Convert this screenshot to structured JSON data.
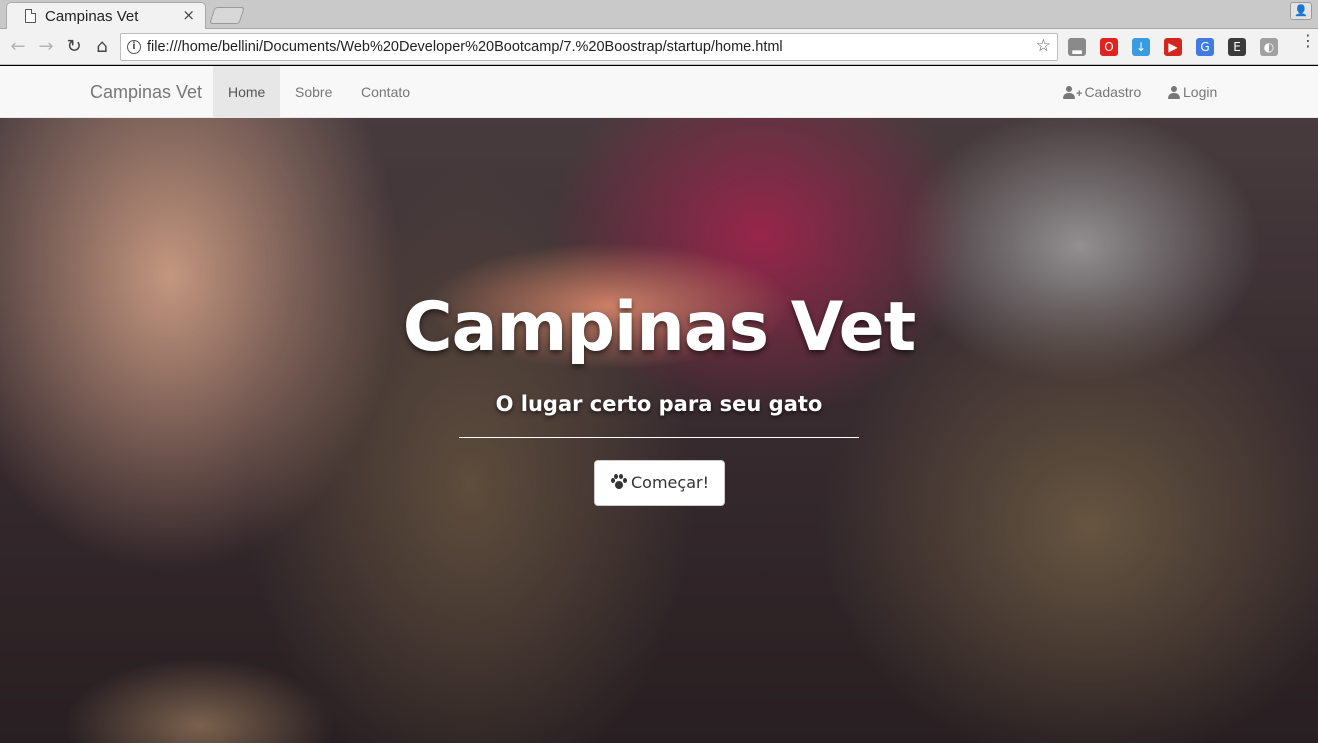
{
  "browser": {
    "tab_title": "Campinas Vet",
    "tab_close": "×",
    "url": "file:///home/bellini/Documents/Web%20Developer%20Bootcamp/7.%20Boostrap/startup/home.html",
    "info_icon": "i",
    "star_icon": "☆",
    "back_icon": "←",
    "forward_icon": "→",
    "reload_icon": "↻",
    "home_icon": "⌂",
    "menu_icon": "⋮",
    "profile_icon": "👤",
    "extensions": [
      {
        "name": "signal-extension-icon",
        "color": "#8a8a8a",
        "glyph": "▂"
      },
      {
        "name": "opera-extension-icon",
        "color": "#e0231f",
        "glyph": "O"
      },
      {
        "name": "download-extension-icon",
        "color": "#3a9ce0",
        "glyph": "↓"
      },
      {
        "name": "red-extension-icon",
        "color": "#d4261f",
        "glyph": "▶"
      },
      {
        "name": "translate-extension-icon",
        "color": "#3f7be0",
        "glyph": "G"
      },
      {
        "name": "evernote-extension-icon",
        "color": "#3b3b3b",
        "glyph": "E"
      },
      {
        "name": "gray-extension-icon",
        "color": "#a0a0a0",
        "glyph": "◐"
      }
    ]
  },
  "navbar": {
    "brand": "Campinas Vet",
    "items": [
      {
        "label": "Home",
        "active": true
      },
      {
        "label": "Sobre",
        "active": false
      },
      {
        "label": "Contato",
        "active": false
      }
    ],
    "right_items": [
      {
        "label": "Cadastro",
        "icon": "user-plus-icon"
      },
      {
        "label": "Login",
        "icon": "user-icon"
      }
    ]
  },
  "hero": {
    "title": "Campinas Vet",
    "subtitle": "O lugar certo para seu gato",
    "button_label": "Começar!",
    "button_icon": "paw-icon"
  }
}
